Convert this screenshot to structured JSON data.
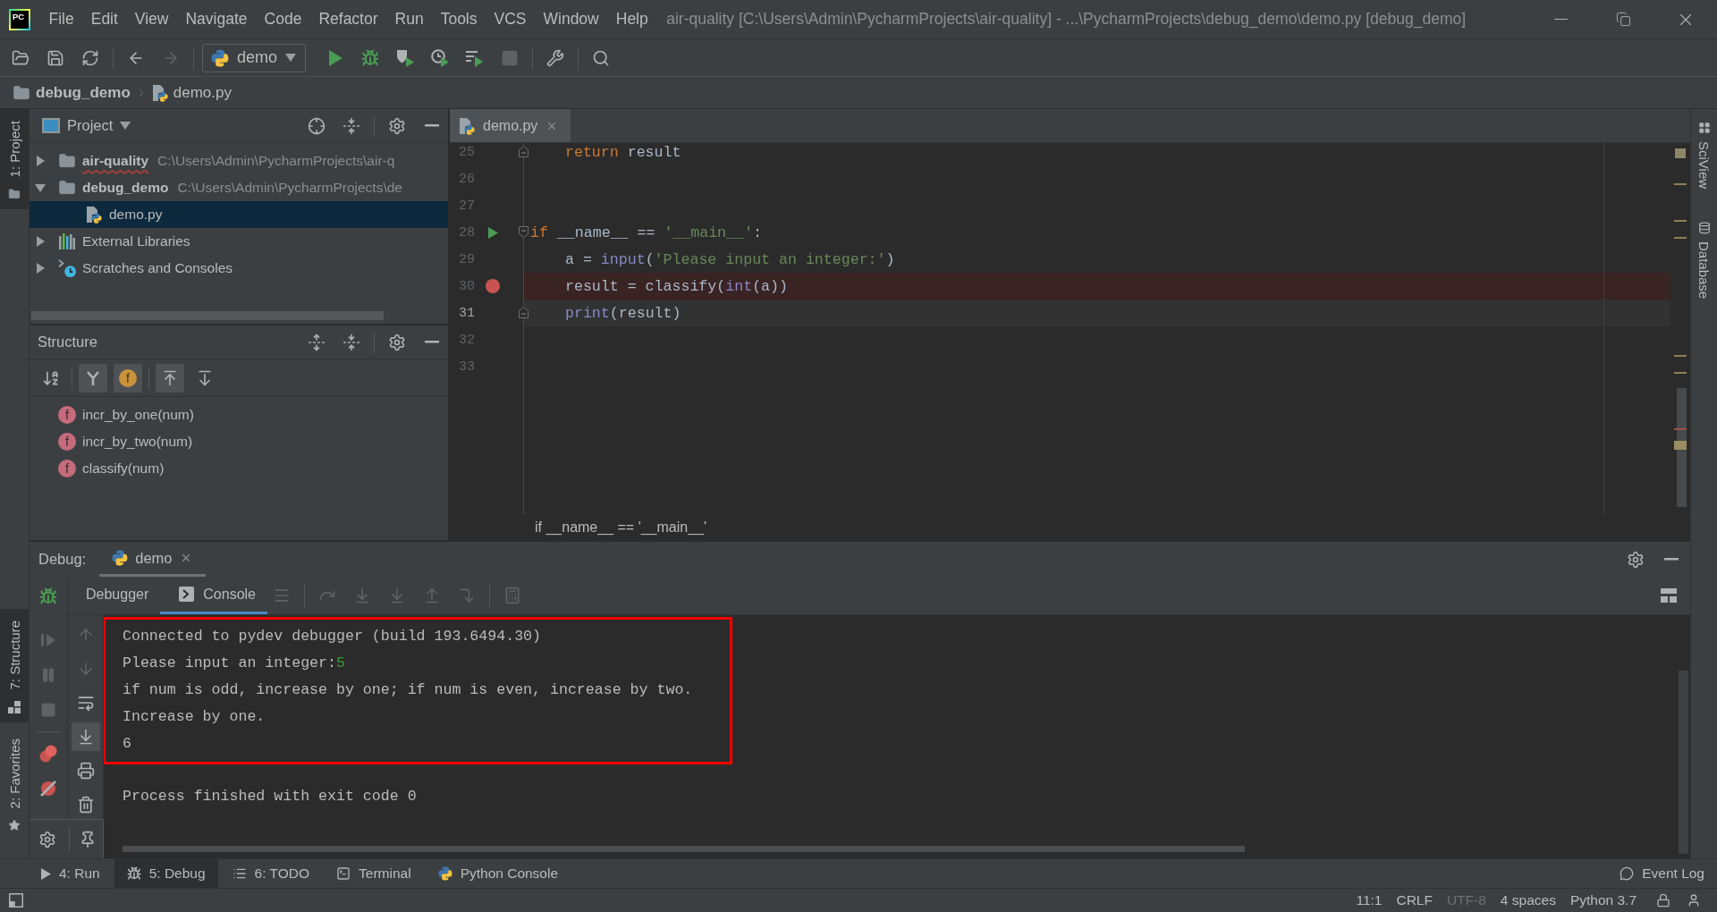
{
  "window": {
    "logo": "PC",
    "title": "air-quality [C:\\Users\\Admin\\PycharmProjects\\air-quality] - ...\\PycharmProjects\\debug_demo\\demo.py [debug_demo]"
  },
  "menu": [
    "File",
    "Edit",
    "View",
    "Navigate",
    "Code",
    "Refactor",
    "Run",
    "Tools",
    "VCS",
    "Window",
    "Help"
  ],
  "toolbar_groups": [
    [
      {
        "kind": "open",
        "disabled": false
      },
      {
        "kind": "save",
        "disabled": false
      },
      {
        "kind": "sync",
        "disabled": false
      }
    ],
    [
      {
        "kind": "back",
        "disabled": false
      },
      {
        "kind": "forward",
        "disabled": true
      }
    ],
    [
      {
        "kind": "run-config",
        "label": "demo"
      },
      {
        "kind": "run",
        "disabled": false
      },
      {
        "kind": "debug",
        "disabled": false
      },
      {
        "kind": "coverage",
        "disabled": false
      },
      {
        "kind": "profile",
        "disabled": false
      },
      {
        "kind": "concurrency",
        "disabled": false
      },
      {
        "kind": "stop",
        "disabled": true
      }
    ],
    [
      {
        "kind": "wrench",
        "disabled": false
      }
    ],
    [
      {
        "kind": "search",
        "disabled": false
      }
    ]
  ],
  "breadcrumbs": [
    {
      "kind": "folder",
      "label": "debug_demo"
    },
    {
      "kind": "python-file",
      "label": "demo.py"
    }
  ],
  "left_stripe": {
    "top": [
      {
        "kind": "project",
        "label": "1: Project",
        "selected": true
      }
    ],
    "bottom": [
      {
        "kind": "structure",
        "label": "7: Structure",
        "selected": true
      },
      {
        "kind": "favorites",
        "label": "2: Favorites",
        "selected": false
      }
    ]
  },
  "project": {
    "title": "Project",
    "tree": [
      {
        "kind": "folder",
        "name": "air-quality",
        "path": "C:\\Users\\Admin\\PycharmProjects\\air-q",
        "expanded": false,
        "selected": false,
        "misspelled": true
      },
      {
        "kind": "folder",
        "name": "debug_demo",
        "path": "C:\\Users\\Admin\\PycharmProjects\\de",
        "expanded": true,
        "selected": false,
        "misspelled": false,
        "children": [
          {
            "kind": "python-file",
            "name": "demo.py",
            "selected": true,
            "misspelled": false
          }
        ]
      },
      {
        "kind": "libraries",
        "name": "External Libraries",
        "expanded": false,
        "selected": false,
        "misspelled": false
      },
      {
        "kind": "scratches",
        "name": "Scratches and Consoles",
        "expanded": false,
        "selected": false,
        "misspelled": false
      }
    ]
  },
  "structure": {
    "title": "Structure",
    "tools": [
      [
        {
          "kind": "sort",
          "on": false
        }
      ],
      [
        {
          "kind": "inherited",
          "on": true
        },
        {
          "kind": "fields",
          "on": true,
          "letter": "f"
        }
      ],
      [
        {
          "kind": "autoscroll-to-source",
          "on": true
        },
        {
          "kind": "autoscroll-from-source",
          "on": false
        }
      ]
    ],
    "items": [
      {
        "badge": "f",
        "label": "incr_by_one(num)"
      },
      {
        "badge": "f",
        "label": "incr_by_two(num)"
      },
      {
        "badge": "f",
        "label": "classify(num)"
      }
    ]
  },
  "editor": {
    "tabs": [
      {
        "label": "demo.py",
        "selected": true
      }
    ],
    "lines": [
      {
        "number": "25",
        "indented": true,
        "fold_start": false,
        "fold_end": true,
        "run_marker": false,
        "breakpoint": false,
        "caret": false,
        "tokens": [
          {
            "kind": "keyword",
            "text": "return"
          },
          {
            "kind": "plain",
            "text": " result"
          }
        ]
      },
      {
        "number": "26",
        "fold_start": false,
        "fold_end": false,
        "run_marker": false,
        "breakpoint": false,
        "caret": false
      },
      {
        "number": "27",
        "fold_start": false,
        "fold_end": false,
        "run_marker": false,
        "breakpoint": false,
        "caret": false
      },
      {
        "number": "28",
        "indented": false,
        "fold_start": true,
        "fold_end": false,
        "run_marker": true,
        "breakpoint": false,
        "caret": false,
        "tokens": [
          {
            "kind": "keyword",
            "text": "if"
          },
          {
            "kind": "plain",
            "text": " __name__ == "
          },
          {
            "kind": "string",
            "text": "'__main__'"
          },
          {
            "kind": "plain",
            "text": ":"
          }
        ]
      },
      {
        "number": "29",
        "indented": true,
        "fold_start": false,
        "fold_end": false,
        "run_marker": false,
        "breakpoint": false,
        "caret": false,
        "tokens": [
          {
            "kind": "plain",
            "text": "a = "
          },
          {
            "kind": "builtin",
            "text": "input"
          },
          {
            "kind": "plain",
            "text": "("
          },
          {
            "kind": "string",
            "text": "'Please input an integer:'"
          },
          {
            "kind": "plain",
            "text": ")"
          }
        ]
      },
      {
        "number": "30",
        "indented": true,
        "fold_start": false,
        "fold_end": false,
        "run_marker": false,
        "breakpoint": true,
        "caret": false,
        "tokens": [
          {
            "kind": "plain",
            "text": "result = classify("
          },
          {
            "kind": "builtin",
            "text": "int"
          },
          {
            "kind": "plain",
            "text": "(a))"
          }
        ]
      },
      {
        "number": "31",
        "indented": true,
        "fold_start": false,
        "fold_end": true,
        "run_marker": false,
        "breakpoint": false,
        "caret": true,
        "tokens": [
          {
            "kind": "builtin",
            "text": "print"
          },
          {
            "kind": "plain",
            "text": "(result)"
          }
        ]
      },
      {
        "number": "32",
        "fold_start": false,
        "fold_end": false,
        "run_marker": false,
        "breakpoint": false,
        "caret": false
      },
      {
        "number": "33",
        "fold_start": false,
        "fold_end": false,
        "run_marker": false,
        "breakpoint": false,
        "caret": false
      }
    ],
    "breadcrumb": "if __name__ == '__main__'"
  },
  "right_stripe": [
    {
      "kind": "sciview",
      "label": "SciView"
    },
    {
      "kind": "database",
      "label": "Database"
    }
  ],
  "debug": {
    "title": "Debug:",
    "sessions": [
      {
        "label": "demo",
        "selected": true
      }
    ],
    "tabs": [
      {
        "kind": "debugger",
        "label": "Debugger",
        "selected": false
      },
      {
        "kind": "console",
        "label": "Console",
        "selected": true
      }
    ],
    "actions": [
      [
        {
          "kind": "threads-menu",
          "disabled": true
        }
      ],
      [
        {
          "kind": "step-over",
          "disabled": true
        },
        {
          "kind": "step-into",
          "disabled": true
        },
        {
          "kind": "step-into-my-code",
          "disabled": true
        },
        {
          "kind": "step-out",
          "disabled": true
        },
        {
          "kind": "run-to-cursor",
          "disabled": true
        }
      ],
      [
        {
          "kind": "evaluate",
          "disabled": true
        }
      ]
    ],
    "side_actions": [
      [
        {
          "kind": "resume",
          "disabled": true
        },
        {
          "kind": "pause",
          "disabled": true
        },
        {
          "kind": "stop",
          "disabled": true
        }
      ],
      [
        {
          "kind": "view-breakpoints",
          "disabled": false
        },
        {
          "kind": "mute-breakpoints",
          "disabled": false
        }
      ]
    ],
    "console_actions": [
      {
        "kind": "up",
        "disabled": true,
        "on": false
      },
      {
        "kind": "down",
        "disabled": true,
        "on": false
      },
      {
        "kind": "soft-wrap",
        "disabled": false,
        "on": false
      },
      {
        "kind": "scroll-to-end",
        "disabled": false,
        "on": true
      },
      {
        "kind": "print",
        "disabled": false,
        "on": false
      },
      {
        "kind": "clear",
        "disabled": false,
        "on": false
      }
    ],
    "console": {
      "blocks": [
        {
          "highlighted": true,
          "lines": [
            {
              "text": "Connected to pydev debugger (build 193.6494.30)"
            },
            {
              "text": "Please input an integer:",
              "input": "5"
            },
            {
              "text": "if num is odd, increase by one; if num is even, increase by two."
            },
            {
              "text": "Increase by one."
            },
            {
              "text": "6"
            }
          ]
        },
        {
          "highlighted": false,
          "lines": [
            {
              "text": "Process finished with exit code 0"
            }
          ]
        }
      ]
    }
  },
  "tool_windows": [
    {
      "kind": "run",
      "label": "4: Run",
      "selected": false
    },
    {
      "kind": "debug",
      "label": "5: Debug",
      "selected": true
    },
    {
      "kind": "todo",
      "label": "6: TODO",
      "selected": false
    },
    {
      "kind": "terminal",
      "label": "Terminal",
      "selected": false
    },
    {
      "kind": "python-console",
      "label": "Python Console",
      "selected": false
    }
  ],
  "event_log": "Event Log",
  "status_bar": [
    {
      "label": "11:1",
      "disabled": false
    },
    {
      "label": "CRLF",
      "disabled": false
    },
    {
      "label": "UTF-8",
      "disabled": true
    },
    {
      "label": "4 spaces",
      "disabled": false
    },
    {
      "label": "Python 3.7",
      "disabled": false
    }
  ]
}
